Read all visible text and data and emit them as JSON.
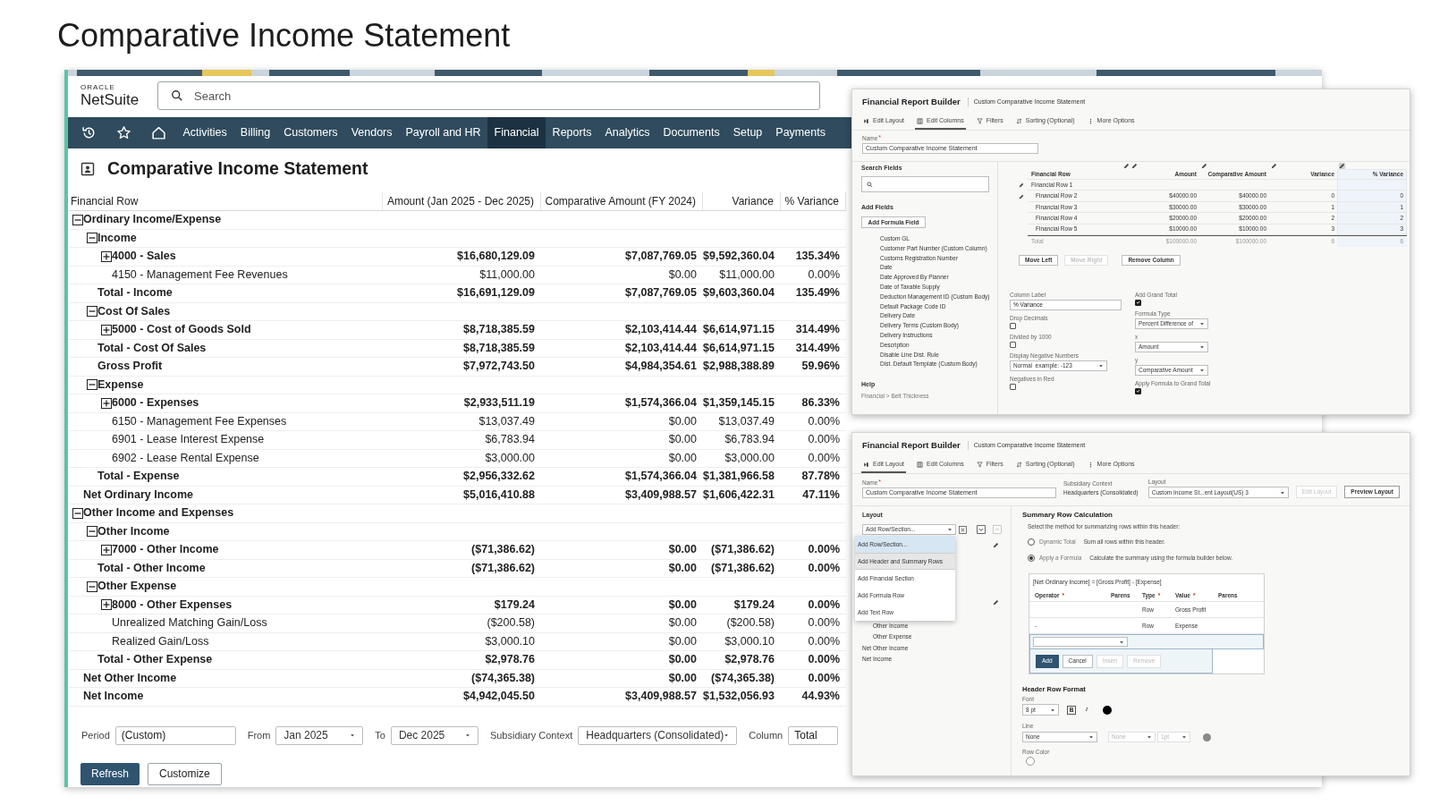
{
  "heading": "Comparative Income Statement",
  "app": {
    "logo_brand": "ORACLE",
    "logo_product": "NetSuite",
    "search_placeholder": "Search",
    "nav": [
      {
        "label": "Activities",
        "selected": false
      },
      {
        "label": "Billing",
        "selected": false
      },
      {
        "label": "Customers",
        "selected": false
      },
      {
        "label": "Vendors",
        "selected": false
      },
      {
        "label": "Payroll and HR",
        "selected": false
      },
      {
        "label": "Financial",
        "selected": true
      },
      {
        "label": "Reports",
        "selected": false
      },
      {
        "label": "Analytics",
        "selected": false
      },
      {
        "label": "Documents",
        "selected": false
      },
      {
        "label": "Setup",
        "selected": false
      },
      {
        "label": "Payments",
        "selected": false
      }
    ]
  },
  "report": {
    "title": "Comparative Income Statement",
    "columns": [
      "Financial Row",
      "Amount (Jan 2025 - Dec 2025)",
      "Comparative Amount (FY 2024)",
      "Variance",
      "% Variance"
    ],
    "rows": [
      {
        "label": "Ordinary Income/Expense",
        "kind": "section",
        "expanded": true,
        "children": [
          {
            "label": "Income",
            "kind": "section",
            "expanded": true,
            "children": [
              {
                "label": "4000 - Sales",
                "kind": "section",
                "expanded": false,
                "values": [
                  "$16,680,129.09",
                  "$7,087,769.05",
                  "$9,592,360.04",
                  "135.34%"
                ]
              },
              {
                "label": "4150 - Management Fee Revenues",
                "kind": "account",
                "values": [
                  "$11,000.00",
                  "$0.00",
                  "$11,000.00",
                  "0.00%"
                ]
              }
            ]
          },
          {
            "label": "Total - Income",
            "kind": "total",
            "values": [
              "$16,691,129.09",
              "$7,087,769.05",
              "$9,603,360.04",
              "135.49%"
            ]
          },
          {
            "label": "Cost Of Sales",
            "kind": "section",
            "expanded": true,
            "children": [
              {
                "label": "5000 - Cost of Goods Sold",
                "kind": "section",
                "expanded": false,
                "values": [
                  "$8,718,385.59",
                  "$2,103,414.44",
                  "$6,614,971.15",
                  "314.49%"
                ]
              }
            ]
          },
          {
            "label": "Total - Cost Of Sales",
            "kind": "total",
            "values": [
              "$8,718,385.59",
              "$2,103,414.44",
              "$6,614,971.15",
              "314.49%"
            ]
          },
          {
            "label": "Gross Profit",
            "kind": "total",
            "values": [
              "$7,972,743.50",
              "$4,984,354.61",
              "$2,988,388.89",
              "59.96%"
            ]
          },
          {
            "label": "Expense",
            "kind": "section",
            "expanded": true,
            "children": [
              {
                "label": "6000 - Expenses",
                "kind": "section",
                "expanded": false,
                "values": [
                  "$2,933,511.19",
                  "$1,574,366.04",
                  "$1,359,145.15",
                  "86.33%"
                ]
              },
              {
                "label": "6150 - Management Fee Expenses",
                "kind": "account",
                "values": [
                  "$13,037.49",
                  "$0.00",
                  "$13,037.49",
                  "0.00%"
                ]
              },
              {
                "label": "6901 - Lease Interest Expense",
                "kind": "account",
                "values": [
                  "$6,783.94",
                  "$0.00",
                  "$6,783.94",
                  "0.00%"
                ]
              },
              {
                "label": "6902 - Lease Rental Expense",
                "kind": "account",
                "values": [
                  "$3,000.00",
                  "$0.00",
                  "$3,000.00",
                  "0.00%"
                ]
              }
            ]
          },
          {
            "label": "Total - Expense",
            "kind": "total",
            "values": [
              "$2,956,332.62",
              "$1,574,366.04",
              "$1,381,966.58",
              "87.78%"
            ]
          }
        ]
      },
      {
        "label": "Net Ordinary Income",
        "kind": "total",
        "values": [
          "$5,016,410.88",
          "$3,409,988.57",
          "$1,606,422.31",
          "47.11%"
        ]
      },
      {
        "label": "Other Income and Expenses",
        "kind": "section",
        "expanded": true,
        "children": [
          {
            "label": "Other Income",
            "kind": "section",
            "expanded": true,
            "children": [
              {
                "label": "7000 - Other Income",
                "kind": "section",
                "expanded": false,
                "values": [
                  "($71,386.62)",
                  "$0.00",
                  "($71,386.62)",
                  "0.00%"
                ]
              }
            ]
          },
          {
            "label": "Total - Other Income",
            "kind": "total",
            "values": [
              "($71,386.62)",
              "$0.00",
              "($71,386.62)",
              "0.00%"
            ]
          },
          {
            "label": "Other Expense",
            "kind": "section",
            "expanded": true,
            "children": [
              {
                "label": "8000 - Other Expenses",
                "kind": "section",
                "expanded": false,
                "values": [
                  "$179.24",
                  "$0.00",
                  "$179.24",
                  "0.00%"
                ]
              },
              {
                "label": "Unrealized Matching Gain/Loss",
                "kind": "account",
                "values": [
                  "($200.58)",
                  "$0.00",
                  "($200.58)",
                  "0.00%"
                ]
              },
              {
                "label": "Realized Gain/Loss",
                "kind": "account",
                "values": [
                  "$3,000.10",
                  "$0.00",
                  "$3,000.10",
                  "0.00%"
                ]
              }
            ]
          },
          {
            "label": "Total - Other Expense",
            "kind": "total",
            "values": [
              "$2,978.76",
              "$0.00",
              "$2,978.76",
              "0.00%"
            ]
          }
        ]
      },
      {
        "label": "Net Other Income",
        "kind": "total",
        "values": [
          "($74,365.38)",
          "$0.00",
          "($74,365.38)",
          "0.00%"
        ]
      },
      {
        "label": "Net Income",
        "kind": "total",
        "values": [
          "$4,942,045.50",
          "$3,409,988.57",
          "$1,532,056.93",
          "44.93%"
        ]
      }
    ]
  },
  "filters": [
    {
      "label": "Period",
      "kind": "text",
      "value": "(Custom)"
    },
    {
      "label": "From",
      "kind": "select",
      "value": "Jan 2025"
    },
    {
      "label": "To",
      "kind": "select",
      "value": "Dec 2025"
    },
    {
      "label": "Subsidiary Context",
      "kind": "select",
      "value": "Headquarters (Consolidated)"
    },
    {
      "label": "Column",
      "kind": "text",
      "value": "Total"
    }
  ],
  "actions": [
    {
      "label": "Refresh",
      "primary": true
    },
    {
      "label": "Customize",
      "primary": false
    }
  ],
  "columns_builder": {
    "title": "Financial Report Builder",
    "subtitle": "Custom Comparative Income Statement",
    "tabs": [
      {
        "label": "Edit Layout",
        "selected": false
      },
      {
        "label": "Edit Columns",
        "selected": true
      },
      {
        "label": "Filters",
        "selected": false
      },
      {
        "label": "Sorting (Optional)",
        "selected": false
      },
      {
        "label": "More Options",
        "selected": false
      }
    ],
    "name_label": "Name",
    "name_required": "*",
    "name_value": "Custom Comparative Income Statement",
    "search_label": "Search Fields",
    "add_fields_label": "Add Fields",
    "add_formula_button": "Add Formula Field",
    "fields": [
      "Custom GL",
      "Customer Part Number (Custom Column)",
      "Customs Registration Number",
      "Date",
      "Date Approved By Planner",
      "Date of Taxable Supply",
      "Deduction Management ID (Custom Body)",
      "Default Package Code ID",
      "Delivery Date",
      "Delivery Terms (Custom Body)",
      "Delivery Instructions",
      "Description",
      "Disable Line Dist. Rule",
      "Dist. Default Template (Custom Body)"
    ],
    "help_label": "Help",
    "help_path": "Financial > Belt Thickness",
    "preview_columns": [
      {
        "label": "Financial Row",
        "selected": false
      },
      {
        "label": "Amount",
        "selected": false
      },
      {
        "label": "Comparative Amount",
        "selected": false
      },
      {
        "label": "Variance",
        "selected": false
      },
      {
        "label": "% Variance",
        "selected": true
      }
    ],
    "preview_rows": [
      {
        "label": "Financial Row 1",
        "editable": true,
        "children": [
          {
            "label": "Financial Row 2",
            "editable": true,
            "values": [
              "$40000.00",
              "$40000.00",
              "0",
              "0"
            ]
          },
          {
            "label": "Financial Row 3",
            "editable": false,
            "values": [
              "$30000.00",
              "$30000.00",
              "1",
              "1"
            ]
          },
          {
            "label": "Financial Row 4",
            "editable": false,
            "values": [
              "$20000.00",
              "$20000.00",
              "2",
              "2"
            ]
          },
          {
            "label": "Financial Row 5",
            "editable": false,
            "values": [
              "$10000.00",
              "$10000.00",
              "3",
              "3"
            ]
          }
        ]
      }
    ],
    "preview_total": {
      "label": "Total",
      "values": [
        "$100000.00",
        "$100000.00",
        "6",
        "6"
      ]
    },
    "buttons": [
      {
        "label": "Move Left",
        "disabled": false
      },
      {
        "label": "Move Right",
        "disabled": true
      },
      {
        "label": "Remove Column",
        "disabled": false
      }
    ],
    "form_left": [
      {
        "kind": "text",
        "label": "Column Label",
        "value": "% Variance"
      },
      {
        "kind": "checkbox",
        "label": "Drop Decimals",
        "checked": false
      },
      {
        "kind": "checkbox",
        "label": "Divided by 1000",
        "checked": false
      },
      {
        "kind": "select",
        "label": "Display Negative Numbers",
        "value": "Normal  example: -123"
      },
      {
        "kind": "checkbox",
        "label": "Negatives in Red",
        "checked": false
      }
    ],
    "form_right": [
      {
        "kind": "checkbox",
        "label": "Add Grand Total",
        "checked": true
      },
      {
        "kind": "select",
        "label": "Formula Type",
        "value": "Percent Difference of"
      },
      {
        "kind": "select",
        "label": "x",
        "value": "Amount"
      },
      {
        "kind": "select",
        "label": "y",
        "value": "Comparative Amount"
      },
      {
        "kind": "checkbox",
        "label": "Apply Formula to Grand Total",
        "checked": true
      }
    ]
  },
  "layout_builder": {
    "title": "Financial Report Builder",
    "subtitle": "Custom Comparative Income Statement",
    "tabs": [
      {
        "label": "Edit Layout",
        "selected": true
      },
      {
        "label": "Edit Columns",
        "selected": false
      },
      {
        "label": "Filters",
        "selected": false
      },
      {
        "label": "Sorting (Optional)",
        "selected": false
      },
      {
        "label": "More Options",
        "selected": false
      }
    ],
    "name_label": "Name",
    "name_required": "*",
    "name_value": "Custom Comparative Income Statement",
    "subsidiary_label": "Subsidiary Context",
    "subsidiary_value": "Headquarters (Consolidated)",
    "layout_label": "Layout",
    "layout_value": "Custom Income St...ent Layout(US) 3",
    "buttons": [
      {
        "label": "Edit Layout",
        "disabled": true
      },
      {
        "label": "Preview Layout",
        "disabled": false
      }
    ],
    "tree_label": "Layout",
    "add_select": "Add Row/Section...",
    "menu": [
      {
        "label": "Add Row/Section...",
        "selected": true,
        "hovered": false
      },
      {
        "label": "Add Header and Summary Rows",
        "selected": false,
        "hovered": true
      },
      {
        "label": "Add Financial Section",
        "selected": false,
        "hovered": false
      },
      {
        "label": "Add Formula Row",
        "selected": false,
        "hovered": false
      },
      {
        "label": "Add Text Row",
        "selected": false,
        "hovered": false
      }
    ],
    "tree": [
      {
        "children": [
          {
            "label": "Other Income"
          },
          {
            "label": "Other Expense"
          }
        ]
      },
      {
        "label": "Net Other Income"
      },
      {
        "label": "Net Income"
      }
    ],
    "summary_title": "Summary Row Calculation",
    "summary_hint": "Select the method for summarizing rows within this header:",
    "methods": [
      {
        "label": "Dynamic Total",
        "description": "Sum all rows within this header.",
        "selected": false
      },
      {
        "label": "Apply a Formula",
        "description": "Calculate the summary using the formula builder below.",
        "selected": true
      }
    ],
    "formula": {
      "expression": "[Net Ordinary Income] = [Gross Profit] - [Expense]",
      "required_mark": "*",
      "columns": [
        {
          "label": "Operator",
          "required": true
        },
        {
          "label": "Parens",
          "required": false
        },
        {
          "label": "Type",
          "required": true
        },
        {
          "label": "Value",
          "required": true
        },
        {
          "label": "Parens",
          "required": false
        }
      ],
      "rows": [
        {
          "type": "Row",
          "value": "Gross Profit"
        },
        {
          "operator": "-",
          "type": "Row",
          "value": "Expense"
        }
      ],
      "buttons": [
        {
          "label": "Add",
          "kind": "primary"
        },
        {
          "label": "Cancel",
          "kind": "cancel"
        },
        {
          "label": "Insert",
          "kind": "disabled"
        },
        {
          "label": "Remove",
          "kind": "disabled"
        }
      ]
    },
    "format": {
      "title": "Header Row Format",
      "font_label": "Font",
      "font_size": "8 pt",
      "bold_button": "B",
      "italic_button": "I",
      "font_swatch": {
        "color": "#000000"
      },
      "line_label": "Line",
      "line_fields": [
        {
          "value": "None",
          "disabled": false
        },
        {
          "value": "None",
          "disabled": true
        },
        {
          "value": "1pt",
          "disabled": true
        }
      ],
      "line_swatch": {
        "color": "#8a8a8a"
      },
      "row_color_label": "Row Color"
    }
  }
}
